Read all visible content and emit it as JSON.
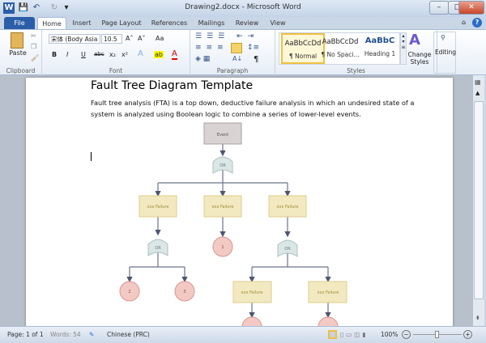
{
  "window": {
    "title": "Drawing2.docx - Microsoft Word",
    "minimize": "–",
    "maximize": "□",
    "close": "✕"
  },
  "quick_access": {
    "word_icon": "W",
    "save": "💾",
    "undo": "↶",
    "redo": "↻",
    "customize": "▾"
  },
  "tabs": [
    "File",
    "Home",
    "Insert",
    "Page Layout",
    "References",
    "Mailings",
    "Review",
    "View"
  ],
  "ribbon": {
    "clipboard": {
      "label": "Clipboard",
      "paste": "Paste"
    },
    "font": {
      "label": "Font",
      "font_name": "宋体 (Body Asia",
      "font_size": "10.5",
      "grow": "A˄",
      "shrink": "A˅",
      "change_case": "Aa",
      "bold": "B",
      "italic": "I",
      "underline": "U",
      "strike": "abc",
      "subscript": "x₂",
      "superscript": "x²",
      "text_effects": "A",
      "highlight": "ab",
      "font_color": "A"
    },
    "paragraph": {
      "label": "Paragraph",
      "show_marks": "¶",
      "sort": "A↓"
    },
    "styles": {
      "label": "Styles",
      "items": [
        {
          "preview": "AaBbCcDd",
          "name": "¶ Normal"
        },
        {
          "preview": "AaBbCcDd",
          "name": "¶ No Spaci..."
        },
        {
          "preview": "AaBbC",
          "name": "Heading 1"
        }
      ],
      "change_styles": "Change Styles"
    },
    "editing": {
      "label": "Editing"
    }
  },
  "document": {
    "title": "Fault Tree Diagram Template",
    "body": "Fault tree analysis (FTA) is a top down, deductive failure analysis in which an undesired state of a system is analyzed using Boolean logic to combine a series of lower-level events.",
    "diagram": {
      "event": "Event",
      "gate": "OR",
      "failure": "xxx Failure",
      "circles": [
        "1",
        "2",
        "3"
      ]
    }
  },
  "status": {
    "page": "Page: 1 of 1",
    "words": "Words: 54",
    "language": "Chinese (PRC)",
    "zoom": "100%",
    "zoom_out": "−",
    "zoom_in": "+",
    "zoom_percent": 100
  }
}
